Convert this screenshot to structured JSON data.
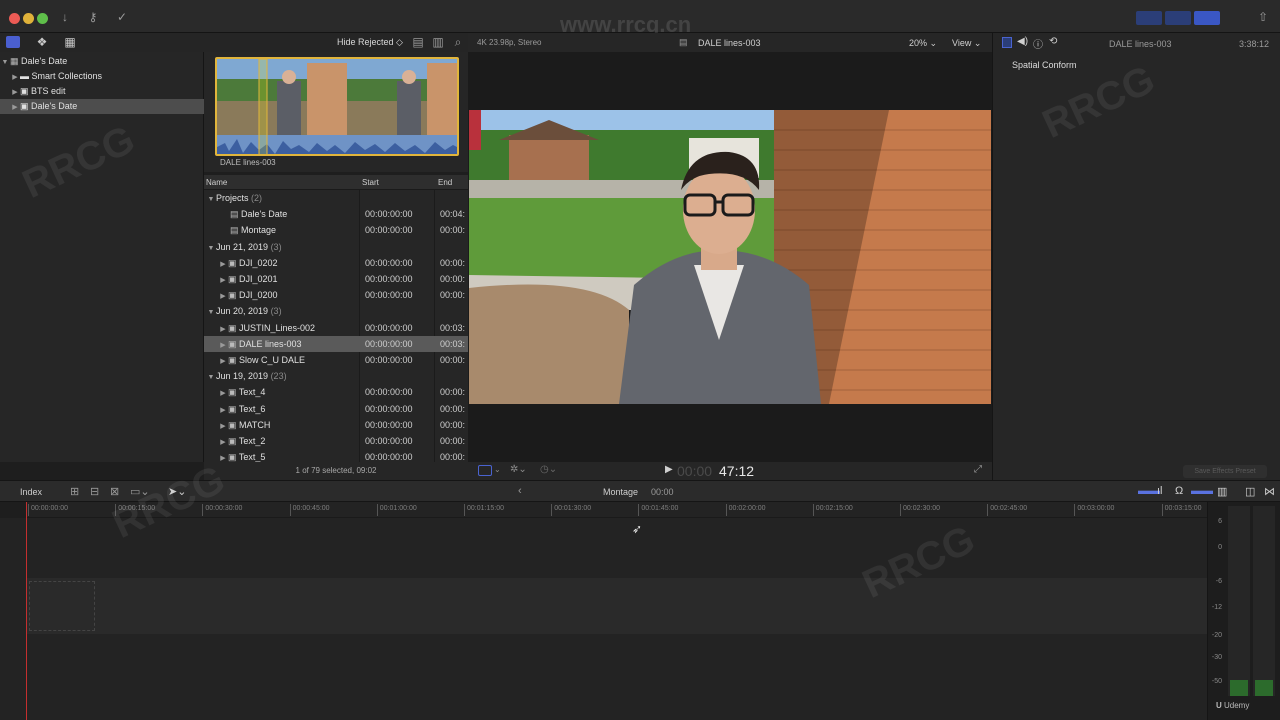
{
  "window": {
    "watermark_url": "www.rrcg.cn"
  },
  "browser": {
    "filter_label": "Hide Rejected",
    "filmstrip_clip_name": "DALE lines-003",
    "columns": {
      "name": "Name",
      "start": "Start",
      "end": "End"
    },
    "footer_status": "1 of 79 selected, 09:02"
  },
  "sidebar": {
    "library": "Dale's Date",
    "items": [
      {
        "label": "Smart Collections"
      },
      {
        "label": "BTS edit"
      },
      {
        "label": "Dale's Date"
      }
    ]
  },
  "list": {
    "rows": [
      {
        "type": "group",
        "label": "Projects",
        "count": "(2)"
      },
      {
        "type": "project",
        "label": "Dale's Date",
        "start": "00:00:00:00",
        "end": "00:04:"
      },
      {
        "type": "project",
        "label": "Montage",
        "start": "00:00:00:00",
        "end": "00:00:"
      },
      {
        "type": "group",
        "label": "Jun 21, 2019",
        "count": "(3)"
      },
      {
        "type": "clip",
        "label": "DJI_0202",
        "start": "00:00:00:00",
        "end": "00:00:"
      },
      {
        "type": "clip",
        "label": "DJI_0201",
        "start": "00:00:00:00",
        "end": "00:00:"
      },
      {
        "type": "clip",
        "label": "DJI_0200",
        "start": "00:00:00:00",
        "end": "00:00:"
      },
      {
        "type": "group",
        "label": "Jun 20, 2019",
        "count": "(3)"
      },
      {
        "type": "clip",
        "label": "JUSTIN_Lines-002",
        "start": "00:00:00:00",
        "end": "00:03:"
      },
      {
        "type": "clip",
        "label": "DALE lines-003",
        "start": "00:00:00:00",
        "end": "00:03:",
        "selected": true
      },
      {
        "type": "clip",
        "label": "Slow C_U DALE",
        "start": "00:00:00:00",
        "end": "00:00:"
      },
      {
        "type": "group",
        "label": "Jun 19, 2019",
        "count": "(23)"
      },
      {
        "type": "clip",
        "label": "Text_4",
        "start": "00:00:00:00",
        "end": "00:00:"
      },
      {
        "type": "clip",
        "label": "Text_6",
        "start": "00:00:00:00",
        "end": "00:00:"
      },
      {
        "type": "clip",
        "label": "MATCH",
        "start": "00:00:00:00",
        "end": "00:00:"
      },
      {
        "type": "clip",
        "label": "Text_2",
        "start": "00:00:00:00",
        "end": "00:00:"
      },
      {
        "type": "clip",
        "label": "Text_5",
        "start": "00:00:00:00",
        "end": "00:00:"
      }
    ]
  },
  "viewer": {
    "format": "4K 23.98p, Stereo",
    "clip_name": "DALE lines-003",
    "zoom": "20%",
    "view_label": "View",
    "timecode": "47:12",
    "timecode_dim": "00:00"
  },
  "inspector": {
    "clip_name": "DALE lines-003",
    "duration": "3:38:12",
    "spatial_conform": "Spatial Conform",
    "save_preset": "Save Effects Preset"
  },
  "timeline": {
    "index_label": "Index",
    "project_name": "Montage",
    "project_time": "00:00",
    "ruler": [
      "00:00:00:00",
      "00:00:15:00",
      "00:00:30:00",
      "00:00:45:00",
      "00:01:00:00",
      "00:01:15:00",
      "00:01:30:00",
      "00:01:45:00",
      "00:02:00:00",
      "00:02:15:00",
      "00:02:30:00",
      "00:02:45:00",
      "00:03:00:00",
      "00:03:15:00"
    ],
    "meter_labels": [
      "6",
      "0",
      "-6",
      "-12",
      "-20",
      "-30",
      "-50"
    ]
  }
}
